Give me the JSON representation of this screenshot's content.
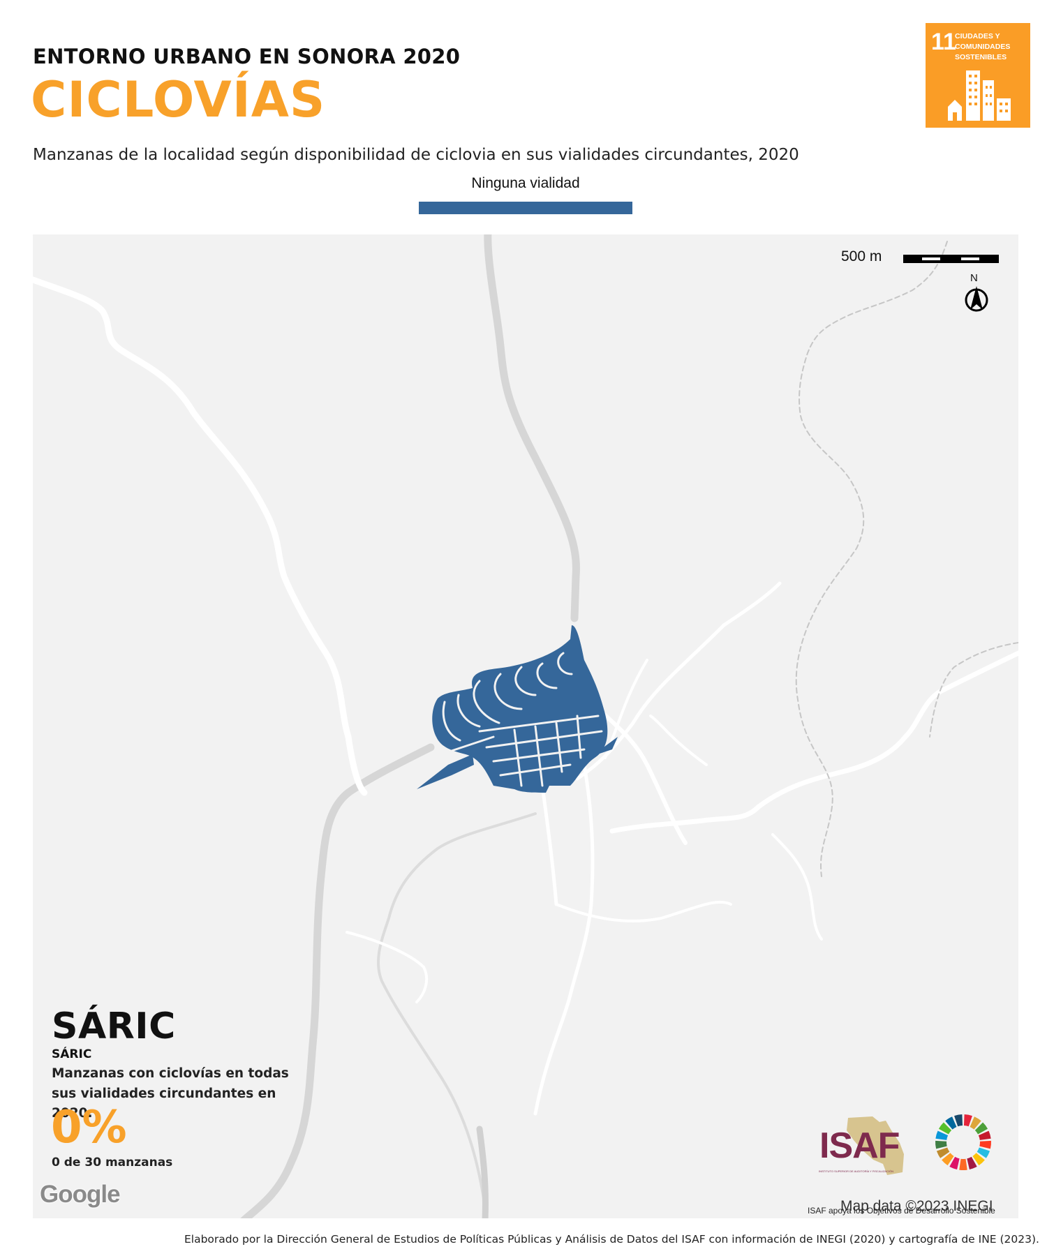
{
  "header": {
    "supertitle": "ENTORNO URBANO EN SONORA 2020",
    "title": "CICLOVÍAS",
    "subtitle": "Manzanas de la localidad según disponibilidad de ciclovia en sus vialidades circundantes, 2020"
  },
  "legend": {
    "label": "Ninguna vialidad",
    "color": "#35679a"
  },
  "sdg_badge": {
    "number": "11",
    "text": "CIUDADES Y COMUNIDADES SOSTENIBLES",
    "color": "#fa9d26",
    "icon": "city-buildings-icon"
  },
  "map": {
    "scale_label": "500 m",
    "north_label": "N",
    "background": "#f2f2f2",
    "block_color": "#35679a"
  },
  "locality": {
    "name_large": "SÁRIC",
    "name_small": "SÁRIC",
    "description": "Manzanas con ciclovías en todas sus vialidades circundantes en 2020.",
    "percentage": "0%",
    "count": "0 de 30 manzanas"
  },
  "attribution": {
    "google": "Google",
    "map_data": "Map data ©2023 INEGI"
  },
  "logos": {
    "isaf_name": "ISAF",
    "isaf_fine": "INSTITUTO SUPERIOR DE AUDITORÍA Y FISCALIZACIÓN",
    "caption": "ISAF apoya los Objetivos de Desarrollo Sostenible"
  },
  "footer": "Elaborado por la Dirección General de Estudios de Políticas Públicas y Análisis de Datos del ISAF con información de INEGI (2020) y cartografía de INE (2023)."
}
